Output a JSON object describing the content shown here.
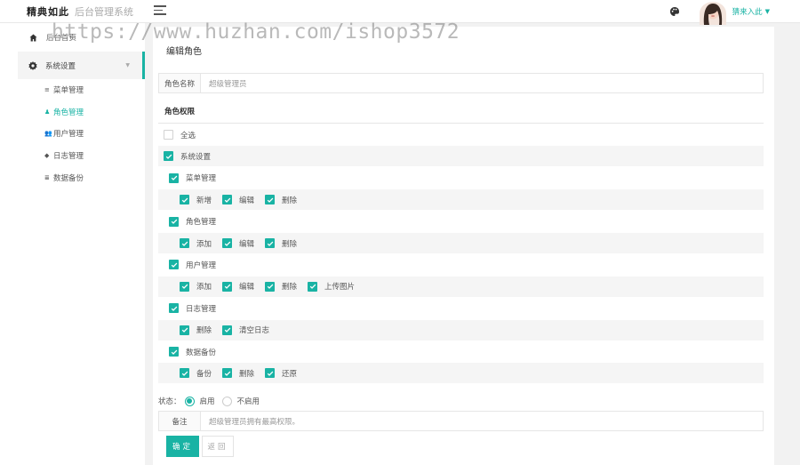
{
  "brand": {
    "name": "精典如此",
    "subtitle": "后台管理系统"
  },
  "watermark": "https://www.huzhan.com/ishop3572",
  "user": {
    "name": "猜来入此"
  },
  "sidebar": {
    "home": "后台首页",
    "group": "系统设置",
    "items": [
      {
        "label": "菜单管理",
        "icon": "list-icon",
        "active": false
      },
      {
        "label": "角色管理",
        "icon": "user-add-icon",
        "active": true
      },
      {
        "label": "用户管理",
        "icon": "users-icon",
        "active": false
      },
      {
        "label": "日志管理",
        "icon": "tag-icon",
        "active": false
      },
      {
        "label": "数据备份",
        "icon": "database-icon",
        "active": false
      }
    ]
  },
  "colors": {
    "accent": "#19b3a4"
  },
  "form": {
    "title": "编辑角色",
    "role_name_label": "角色名称",
    "role_name_value": "超级管理员",
    "permissions_title": "角色权限",
    "select_all": "全选",
    "root": "系统设置",
    "modules": [
      {
        "label": "菜单管理",
        "actions": [
          "新增",
          "编辑",
          "删除"
        ]
      },
      {
        "label": "角色管理",
        "actions": [
          "添加",
          "编辑",
          "删除"
        ]
      },
      {
        "label": "用户管理",
        "actions": [
          "添加",
          "编辑",
          "删除",
          "上传图片"
        ]
      },
      {
        "label": "日志管理",
        "actions": [
          "删除",
          "清空日志"
        ]
      },
      {
        "label": "数据备份",
        "actions": [
          "备份",
          "删除",
          "还原"
        ]
      }
    ],
    "status_label": "状态：",
    "status_on": "启用",
    "status_off": "不启用",
    "remark_label": "备注",
    "remark_value": "超级管理员拥有最高权限。",
    "confirm": "确定",
    "back": "返回"
  }
}
